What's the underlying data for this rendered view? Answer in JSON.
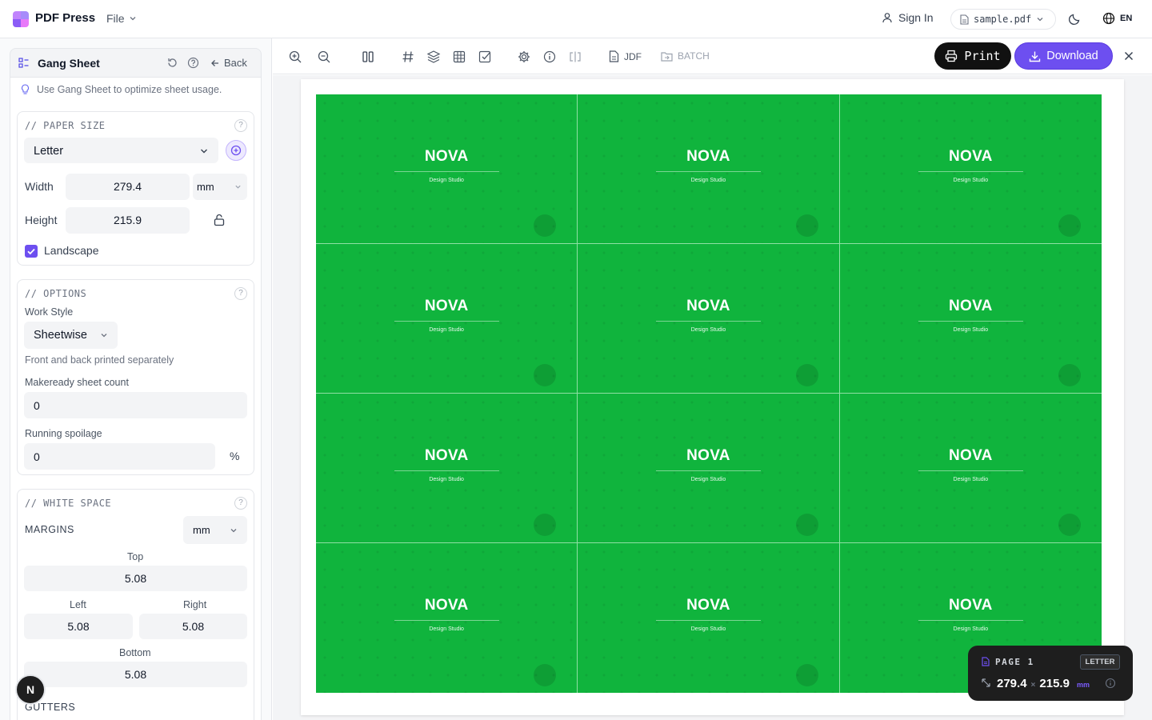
{
  "app": {
    "name": "PDF Press",
    "file_menu": "File"
  },
  "header": {
    "sign_in": "Sign In",
    "file_name": "sample.pdf",
    "language": "EN"
  },
  "sidebar": {
    "title": "Gang Sheet",
    "back": "Back",
    "tip": "Use Gang Sheet to optimize sheet usage.",
    "paper_size": {
      "title": "// PAPER SIZE",
      "preset": "Letter",
      "width_label": "Width",
      "width": "279.4",
      "unit": "mm",
      "height_label": "Height",
      "height": "215.9",
      "landscape_label": "Landscape",
      "landscape": true
    },
    "options": {
      "title": "// OPTIONS",
      "work_style_label": "Work Style",
      "work_style": "Sheetwise",
      "work_style_desc": "Front and back printed separately",
      "makeready_label": "Makeready sheet count",
      "makeready": "0",
      "spoilage_label": "Running spoilage",
      "spoilage": "0",
      "spoilage_unit": "%"
    },
    "white_space": {
      "title": "// WHITE SPACE",
      "margins_label": "MARGINS",
      "margins_unit": "mm",
      "top_label": "Top",
      "top": "5.08",
      "left_label": "Left",
      "left": "5.08",
      "right_label": "Right",
      "right": "5.08",
      "bottom_label": "Bottom",
      "bottom": "5.08",
      "gutters_label": "GUTTERS"
    },
    "avatar": "N"
  },
  "toolbar": {
    "jdf": "JDF",
    "batch": "BATCH",
    "print": "Print",
    "download": "Download"
  },
  "sheet": {
    "brand": "NOVA",
    "tagline": "Design Studio",
    "tile_count": 12,
    "tile_color": "#10b43d"
  },
  "page_badge": {
    "page": "PAGE 1",
    "size": "LETTER",
    "width": "279.4",
    "times": "×",
    "height": "215.9",
    "unit": "mm"
  },
  "colors": {
    "accent": "#6d4ff0",
    "dark": "#111111"
  }
}
